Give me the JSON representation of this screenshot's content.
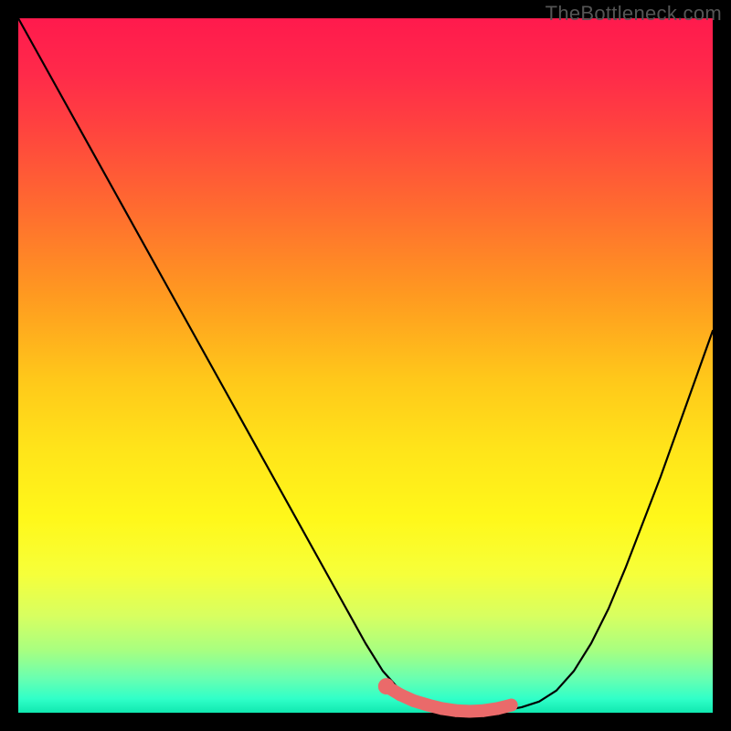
{
  "watermark": "TheBottleneck.com",
  "colors": {
    "frame_bg": "#000000",
    "curve_stroke": "#000000",
    "marker_fill": "#ea6a6a",
    "marker_stroke": "#c94f4f"
  },
  "chart_data": {
    "type": "line",
    "title": "",
    "xlabel": "",
    "ylabel": "",
    "xlim": [
      0,
      100
    ],
    "ylim": [
      0,
      100
    ],
    "grid": false,
    "series": [
      {
        "name": "bottleneck-curve",
        "x": [
          0,
          5,
          10,
          15,
          20,
          25,
          30,
          35,
          40,
          45,
          50,
          52.5,
          55,
          57.5,
          60,
          62.5,
          65,
          67.5,
          70,
          72.5,
          75,
          77.5,
          80,
          82.5,
          85,
          87.5,
          90,
          92.5,
          95,
          97.5,
          100
        ],
        "values": [
          100,
          91,
          82,
          73,
          64,
          55,
          46,
          37,
          28,
          19,
          10,
          6.0,
          3.2,
          1.6,
          0.8,
          0.3,
          0.1,
          0.1,
          0.3,
          0.8,
          1.6,
          3.2,
          6.0,
          10.0,
          15.0,
          21.0,
          27.5,
          34.0,
          41.0,
          48.0,
          55.0
        ]
      }
    ],
    "markers": {
      "name": "highlight-segment",
      "x": [
        53,
        55,
        57,
        59,
        61,
        63,
        65,
        67,
        69,
        71
      ],
      "values": [
        3.8,
        2.6,
        1.7,
        1.1,
        0.6,
        0.3,
        0.2,
        0.3,
        0.6,
        1.1
      ]
    }
  }
}
